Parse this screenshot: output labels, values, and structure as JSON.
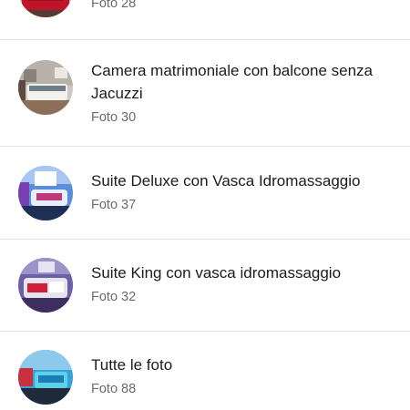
{
  "albums": [
    {
      "title": "",
      "count_label": "Foto 28",
      "thumb_icon": "room-photo-red-bedding"
    },
    {
      "title": "Camera matrimoniale con balcone senza Jacuzzi",
      "count_label": "Foto 30",
      "thumb_icon": "room-photo-double-bed"
    },
    {
      "title": "Suite Deluxe con Vasca Idromassaggio",
      "count_label": "Foto 37",
      "thumb_icon": "room-photo-blue-suite"
    },
    {
      "title": "Suite King con vasca idromassaggio",
      "count_label": "Foto 32",
      "thumb_icon": "room-photo-king-suite"
    },
    {
      "title": "Tutte le foto",
      "count_label": "Foto 88",
      "thumb_icon": "room-photo-all"
    }
  ],
  "colors": {
    "divider": "#e3e3e3",
    "title_text": "#1b1b1b",
    "count_text": "#6b6b6b"
  }
}
